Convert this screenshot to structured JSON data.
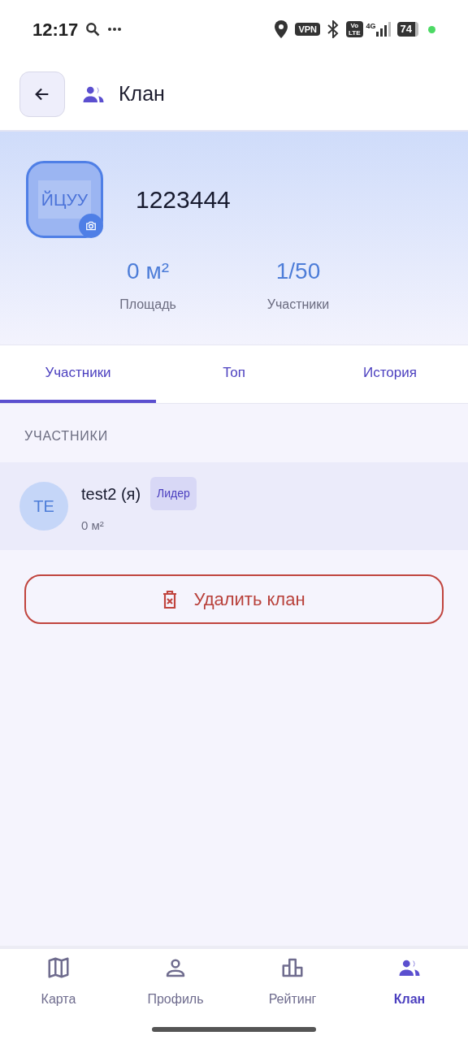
{
  "status_bar": {
    "time": "12:17",
    "vpn": "VPN",
    "volte": [
      "Vo",
      "LTE"
    ],
    "network": "4G",
    "battery": "74"
  },
  "header": {
    "title": "Клан"
  },
  "clan": {
    "emblem": "ЙЦУУ",
    "name": "1223444",
    "stats": [
      {
        "value": "0 м²",
        "label": "Площадь"
      },
      {
        "value": "1/50",
        "label": "Участники"
      }
    ]
  },
  "tabs": [
    {
      "label": "Участники",
      "selected": true
    },
    {
      "label": "Топ",
      "selected": false
    },
    {
      "label": "История",
      "selected": false
    }
  ],
  "section_title": "УЧАСТНИКИ",
  "members": [
    {
      "initials": "TE",
      "name": "test2 (я)",
      "role": "Лидер",
      "area": "0 м²"
    }
  ],
  "delete_button": "Удалить клан",
  "nav": [
    {
      "label": "Карта",
      "kind": "map",
      "selected": false
    },
    {
      "label": "Профиль",
      "kind": "profile",
      "selected": false
    },
    {
      "label": "Рейтинг",
      "kind": "rating",
      "selected": false
    },
    {
      "label": "Клан",
      "kind": "clan",
      "selected": true
    }
  ]
}
